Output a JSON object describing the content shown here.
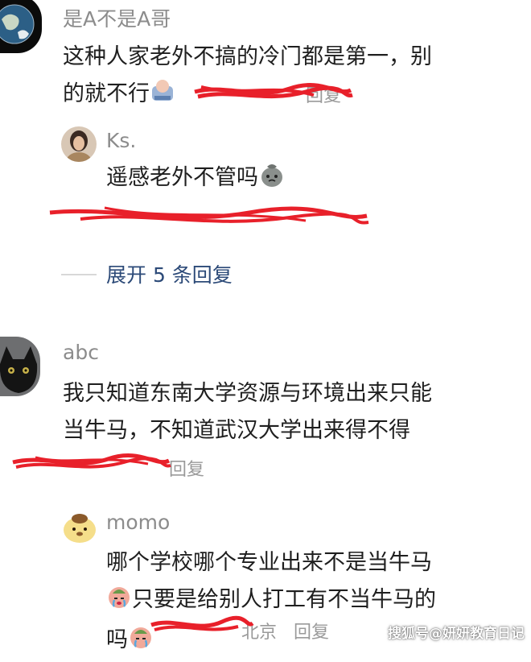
{
  "comments": [
    {
      "username": "是A不是A哥",
      "line1": "这种人家老外不搞的冷门都是第一，别",
      "line2": "的就不行",
      "reply_label": "回复",
      "replies": [
        {
          "username": "Ks.",
          "text": "遥感老外不管吗"
        }
      ],
      "expand_label": "展开 5 条回复"
    },
    {
      "username": "abc",
      "line1": "我只知道东南大学资源与环境出来只能",
      "line2": "当牛马，不知道武汉大学出来得不得",
      "reply_label": "回复",
      "replies": [
        {
          "username": "momo",
          "line1": "哪个学校哪个专业出来不是当牛马",
          "line2": "只要是给别人打工有不当牛马的",
          "line3": "吗",
          "location": "北京",
          "reply_label": "回复"
        }
      ]
    }
  ],
  "watermark": "搜狐号@妍妍教育日记",
  "colors": {
    "scribble_red": "#e8202a",
    "username_gray": "#8c8c8c",
    "expand_blue": "#2c4a78"
  },
  "icons": [
    "globe-avatar",
    "woman-avatar",
    "black-cat-avatar",
    "pompompurin-avatar",
    "money-bag-emoji",
    "crying-emoji",
    "sticker-emoji"
  ]
}
